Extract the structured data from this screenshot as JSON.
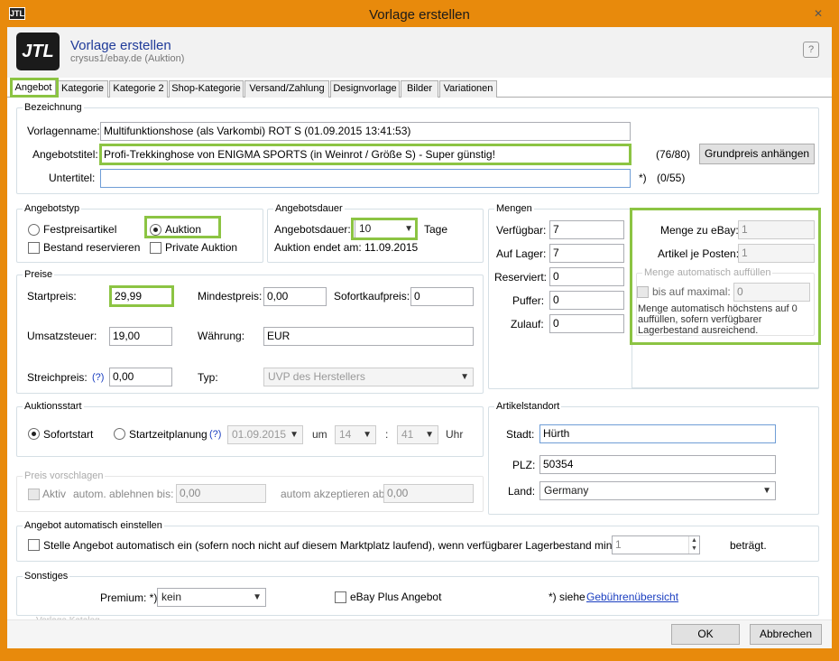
{
  "window": {
    "title": "Vorlage erstellen",
    "logo": "JTL"
  },
  "header": {
    "title": "Vorlage erstellen",
    "subtitle": "crysus1/ebay.de (Auktion)",
    "help_icon": "?"
  },
  "tabs": [
    "Angebot",
    "Kategorie",
    "Kategorie 2",
    "Shop-Kategorie",
    "Versand/Zahlung",
    "Designvorlage",
    "Bilder",
    "Variationen"
  ],
  "bezeichnung": {
    "title": "Bezeichnung",
    "vorlagenname_label": "Vorlagenname:",
    "vorlagenname_value": "Multifunktionshose (als Varkombi) ROT S  (01.09.2015 13:41:53)",
    "angebotstitel_label": "Angebotstitel:",
    "angebotstitel_value": "Profi-Trekkinghose von ENIGMA SPORTS (in Weinrot / Größe S) - Super günstig!",
    "angebotstitel_count": "(76/80)",
    "grundpreis_button": "Grundpreis anhängen",
    "untertitel_label": "Untertitel:",
    "untertitel_marker": "*)",
    "untertitel_count": "(0/55)"
  },
  "angebotstyp": {
    "title": "Angebotstyp",
    "festpreis": "Festpreisartikel",
    "auktion": "Auktion",
    "bestand": "Bestand reservieren",
    "private": "Private Auktion"
  },
  "dauer": {
    "title": "Angebotsdauer",
    "label": "Angebotsdauer:",
    "value": "10",
    "unit": "Tage",
    "ende": "Auktion endet am: 11.09.2015"
  },
  "mengen": {
    "title": "Mengen",
    "rows": [
      {
        "label": "Verfügbar:",
        "value": "7"
      },
      {
        "label": "Auf Lager:",
        "value": "7"
      },
      {
        "label": "Reserviert:",
        "value": "0"
      },
      {
        "label": "Puffer:",
        "value": "0"
      },
      {
        "label": "Zulauf:",
        "value": "0"
      }
    ],
    "menge_ebay_label": "Menge zu eBay:",
    "menge_ebay_value": "1",
    "artikel_label": "Artikel je Posten:",
    "artikel_value": "1",
    "auto_title": "Menge automatisch auffüllen",
    "bis_label": "bis auf maximal:",
    "bis_value": "0",
    "auto_text": "Menge automatisch höchstens auf 0 auffüllen, sofern verfügbarer Lagerbestand ausreichend."
  },
  "preise": {
    "title": "Preise",
    "startpreis_label": "Startpreis:",
    "startpreis_value": "29,99",
    "mindest_label": "Mindestpreis:",
    "mindest_value": "0,00",
    "sofort_label": "Sofortkaufpreis:",
    "sofort_value": "0",
    "ust_label": "Umsatzsteuer:",
    "ust_value": "19,00",
    "waehrung_label": "Währung:",
    "waehrung_value": "EUR",
    "streich_label": "Streichpreis:",
    "streich_help": "(?)",
    "streich_value": "0,00",
    "typ_label": "Typ:",
    "typ_value": "UVP des Herstellers"
  },
  "auktionsstart": {
    "title": "Auktionsstart",
    "sofort": "Sofortstart",
    "planung": "Startzeitplanung",
    "help": "(?)",
    "datum": "01.09.2015",
    "um": "um",
    "stunde": "14",
    "minute": "41",
    "colon": ":",
    "uhr": "Uhr"
  },
  "standort": {
    "title": "Artikelstandort",
    "stadt_label": "Stadt:",
    "stadt_value": "Hürth",
    "plz_label": "PLZ:",
    "plz_value": "50354",
    "land_label": "Land:",
    "land_value": "Germany"
  },
  "vorschlag": {
    "title": "Preis vorschlagen",
    "aktiv": "Aktiv",
    "ablehnen_label": "autom. ablehnen bis:",
    "ablehnen_value": "0,00",
    "akzeptieren_label": "autom akzeptieren ab:",
    "akzeptieren_value": "0,00"
  },
  "auto": {
    "title": "Angebot automatisch einstellen",
    "text": "Stelle Angebot automatisch ein (sofern noch nicht auf diesem Marktplatz laufend), wenn verfügbarer Lagerbestand mindestens",
    "value": "1",
    "suffix": "beträgt."
  },
  "sonstiges": {
    "title": "Sonstiges",
    "premium_label": "Premium: *)",
    "premium_value": "kein",
    "ebayplus": "eBay Plus Angebot",
    "gebuehren_prefix": "*) siehe",
    "gebuehren_link": "Gebührenübersicht",
    "katalog": "Vorlage Katalog"
  },
  "footer": {
    "ok": "OK",
    "abbrechen": "Abbrechen"
  },
  "colors": {
    "highlight": "#8cc443",
    "frame": "#e88a0c",
    "accent": "#1f3b99"
  }
}
